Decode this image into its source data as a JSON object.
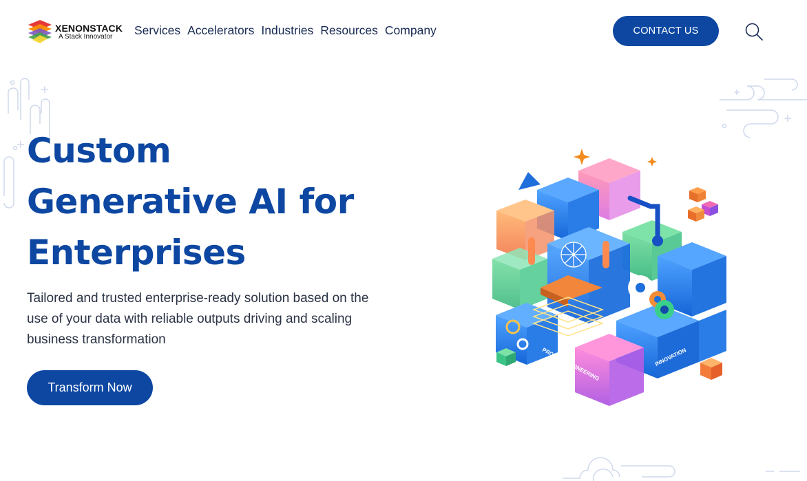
{
  "brand": {
    "name": "XENONSTACK",
    "tagline": "A Stack Innovator"
  },
  "nav": {
    "items": [
      {
        "label": "Services"
      },
      {
        "label": "Accelerators"
      },
      {
        "label": "Industries"
      },
      {
        "label": "Resources"
      },
      {
        "label": "Company"
      }
    ]
  },
  "header": {
    "contact_label": "CONTACT US"
  },
  "hero": {
    "title_lines": [
      "Custom",
      "Generative AI for",
      "Enterprises"
    ],
    "description": "Tailored and trusted enterprise-ready solution based on the use of your data with reliable outputs driving and scaling business transformation",
    "cta_label": "Transform Now"
  },
  "illustration": {
    "label_prompt": "PROMPT ENGINEERING",
    "label_innovation": "INNOVATION"
  },
  "colors": {
    "primary": "#0d47a1",
    "text": "#2b3345",
    "nav_text": "#1a2c55",
    "deco_line": "#cfd9ec"
  }
}
